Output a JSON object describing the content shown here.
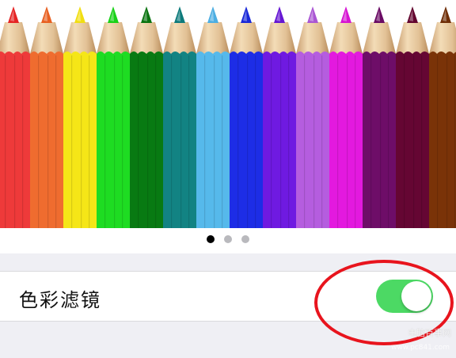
{
  "carousel": {
    "pencils": [
      {
        "color": "#ee3a3a",
        "lead": "#e52424"
      },
      {
        "color": "#ef6c2f",
        "lead": "#e86021"
      },
      {
        "color": "#f5e617",
        "lead": "#f1de12"
      },
      {
        "color": "#1edc22",
        "lead": "#19d118"
      },
      {
        "color": "#087a12",
        "lead": "#0a7410"
      },
      {
        "color": "#128383",
        "lead": "#0d7a7b"
      },
      {
        "color": "#56b9eb",
        "lead": "#4daee2"
      },
      {
        "color": "#1d2de6",
        "lead": "#1928d8"
      },
      {
        "color": "#6f1ae1",
        "lead": "#6617d3"
      },
      {
        "color": "#b55ddf",
        "lead": "#aa56d3"
      },
      {
        "color": "#e319df",
        "lead": "#d614d3"
      },
      {
        "color": "#6e0d68",
        "lead": "#6a0b64"
      },
      {
        "color": "#650633",
        "lead": "#63052f"
      },
      {
        "color": "#7a3308",
        "lead": "#6f2e07"
      }
    ],
    "dots": [
      {
        "active": true
      },
      {
        "active": false
      },
      {
        "active": false
      }
    ]
  },
  "settings": {
    "color_filter_label": "色彩滤镜",
    "color_filter_enabled": true
  },
  "annotation": {
    "color": "#e8141d"
  },
  "watermark": {
    "text": "电脑百事网",
    "subtext": "www.pc841.com"
  }
}
